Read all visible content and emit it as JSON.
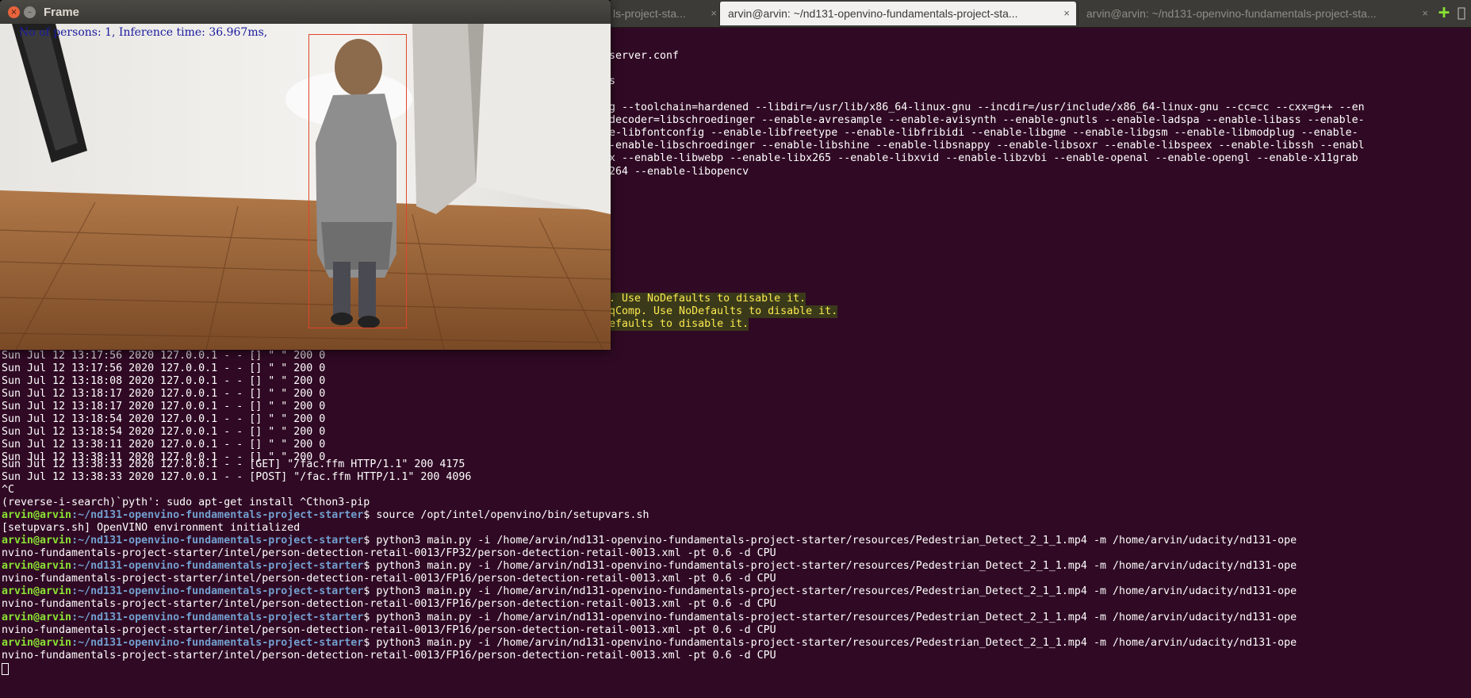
{
  "tabs": [
    {
      "label": "ls-project-sta...",
      "close": "×"
    },
    {
      "label": "arvin@arvin: ~/nd131-openvino-fundamentals-project-sta...",
      "close": "×"
    },
    {
      "label": "arvin@arvin: ~/nd131-openvino-fundamentals-project-sta...",
      "close": "×"
    }
  ],
  "new_tab_icon": "+",
  "frame_window": {
    "title": "Frame",
    "close_glyph": "×",
    "minimize_glyph": "–",
    "overlay": "No of persons: 1, Inference time: 36.967ms,"
  },
  "terminal_fragments": [
    "server.conf",
    "s",
    "g --toolchain=hardened --libdir=/usr/lib/x86_64-linux-gnu --incdir=/usr/include/x86_64-linux-gnu --cc=cc --cxx=g++ --en",
    "decoder=libschroedinger --enable-avresample --enable-avisynth --enable-gnutls --enable-ladspa --enable-libass --enable-",
    "e-libfontconfig --enable-libfreetype --enable-libfribidi --enable-libgme --enable-libgsm --enable-libmodplug --enable-",
    "-enable-libschroedinger --enable-libshine --enable-libsnappy --enable-libsoxr --enable-libspeex --enable-libssh --enabl",
    "x --enable-libwebp --enable-libx265 --enable-libxvid --enable-libzvbi --enable-openal --enable-opengl --enable-x11grab",
    "264 --enable-libopencv"
  ],
  "warnings": [
    ". Use NoDefaults to disable it.",
    "qComp. Use NoDefaults to disable it.",
    "efaults to disable it."
  ],
  "log_lines": [
    "Sun Jul 12 13:17:56 2020 127.0.0.1 - - [] \" \" 200 0",
    "Sun Jul 12 13:17:56 2020 127.0.0.1 - - [] \" \" 200 0",
    "Sun Jul 12 13:18:08 2020 127.0.0.1 - - [] \" \" 200 0",
    "Sun Jul 12 13:18:17 2020 127.0.0.1 - - [] \" \" 200 0",
    "Sun Jul 12 13:18:17 2020 127.0.0.1 - - [] \" \" 200 0",
    "Sun Jul 12 13:18:54 2020 127.0.0.1 - - [] \" \" 200 0",
    "Sun Jul 12 13:18:54 2020 127.0.0.1 - - [] \" \" 200 0",
    "Sun Jul 12 13:38:11 2020 127.0.0.1 - - [] \" \" 200 0",
    "Sun Jul 12 13:38:11 2020 127.0.0.1 - - [] \" \" 200 0",
    "Sun Jul 12 13:38:33 2020 127.0.0.1 - - [GET] \"/fac.ffm HTTP/1.1\" 200 4175",
    "Sun Jul 12 13:38:33 2020 127.0.0.1 - - [POST] \"/fac.ffm HTTP/1.1\" 200 4096",
    "^C",
    "(reverse-i-search)`pyth': sudo apt-get install ^Cthon3-pip"
  ],
  "prompt": {
    "user": "arvin@arvin",
    "path": ":~/nd131-openvino-fundamentals-project-starter",
    "sign": "$ "
  },
  "source_command": "source /opt/intel/openvino/bin/setupvars.sh",
  "setupvars_output": "[setupvars.sh] OpenVINO environment initialized",
  "runs": [
    {
      "cmd": "python3 main.py -i /home/arvin/nd131-openvino-fundamentals-project-starter/resources/Pedestrian_Detect_2_1_1.mp4 -m /home/arvin/udacity/nd131-ope",
      "cont": "nvino-fundamentals-project-starter/intel/person-detection-retail-0013/FP32/person-detection-retail-0013.xml -pt 0.6 -d CPU"
    },
    {
      "cmd": "python3 main.py -i /home/arvin/nd131-openvino-fundamentals-project-starter/resources/Pedestrian_Detect_2_1_1.mp4 -m /home/arvin/udacity/nd131-ope",
      "cont": "nvino-fundamentals-project-starter/intel/person-detection-retail-0013/FP16/person-detection-retail-0013.xml -pt 0.6 -d CPU"
    },
    {
      "cmd": "python3 main.py -i /home/arvin/nd131-openvino-fundamentals-project-starter/resources/Pedestrian_Detect_2_1_1.mp4 -m /home/arvin/udacity/nd131-ope",
      "cont": "nvino-fundamentals-project-starter/intel/person-detection-retail-0013/FP16/person-detection-retail-0013.xml -pt 0.6 -d CPU"
    },
    {
      "cmd": "python3 main.py -i /home/arvin/nd131-openvino-fundamentals-project-starter/resources/Pedestrian_Detect_2_1_1.mp4 -m /home/arvin/udacity/nd131-ope",
      "cont": "nvino-fundamentals-project-starter/intel/person-detection-retail-0013/FP16/person-detection-retail-0013.xml -pt 0.6 -d CPU"
    },
    {
      "cmd": "python3 main.py -i /home/arvin/nd131-openvino-fundamentals-project-starter/resources/Pedestrian_Detect_2_1_1.mp4 -m /home/arvin/udacity/nd131-ope",
      "cont": "nvino-fundamentals-project-starter/intel/person-detection-retail-0013/FP16/person-detection-retail-0013.xml -pt 0.6 -d CPU"
    }
  ],
  "colors": {
    "terminal_bg": "#300a24",
    "prompt_user": "#8ae234",
    "prompt_path": "#729fcf",
    "warning_text": "#fce94f",
    "bbox": "#e0452a"
  }
}
